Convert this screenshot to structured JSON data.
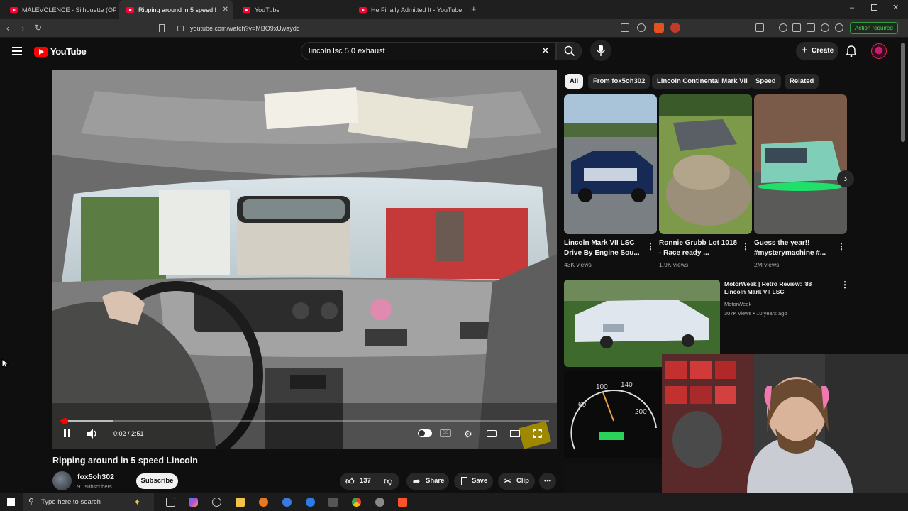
{
  "browser": {
    "tabs": [
      {
        "title": "MALEVOLENCE - Silhouette (OFFICIA",
        "active": false
      },
      {
        "title": "Ripping around in 5 speed Li",
        "active": true
      },
      {
        "title": "YouTube",
        "active": false
      },
      {
        "title": "He Finally Admitted It - YouTube",
        "active": false
      }
    ],
    "url": "youtube.com/watch?v=MBO9xUwaydc",
    "action_required": "Action required"
  },
  "header": {
    "logo": "YouTube",
    "search_query": "lincoln lsc 5.0 exhaust",
    "create_label": "Create"
  },
  "player": {
    "current_time": "0:02 / 2:51",
    "progress": 0.012,
    "buffered": 0.11
  },
  "video": {
    "title": "Ripping around in 5 speed Lincoln",
    "channel": "fox5oh302",
    "subscribers": "91 subscribers",
    "subscribe_label": "Subscribe",
    "likes": "137",
    "share_label": "Share",
    "save_label": "Save",
    "clip_label": "Clip"
  },
  "chips": [
    "All",
    "From fox5oh302",
    "Lincoln Continental Mark VII",
    "Speed",
    "Related"
  ],
  "shorts": [
    {
      "title": "Lincoln Mark VII LSC Drive By Engine Sou...",
      "views": "43K views"
    },
    {
      "title": "Ronnie Grubb Lot 1018 - Race ready ...",
      "views": "1.9K views"
    },
    {
      "title": "Guess the year!! #mysterymachine #...",
      "views": "2M views"
    }
  ],
  "recommended": [
    {
      "title": "MotorWeek | Retro Review: '88 Lincoln Mark VII LSC",
      "channel": "MotorWeek",
      "meta": "307K views • 10 years ago"
    }
  ],
  "taskbar": {
    "search_placeholder": "Type here to search"
  },
  "colors": {
    "background": "#0f0f0f",
    "accent": "#ff0000",
    "chip_bg": "#272727",
    "action_green": "#4ed15e"
  }
}
